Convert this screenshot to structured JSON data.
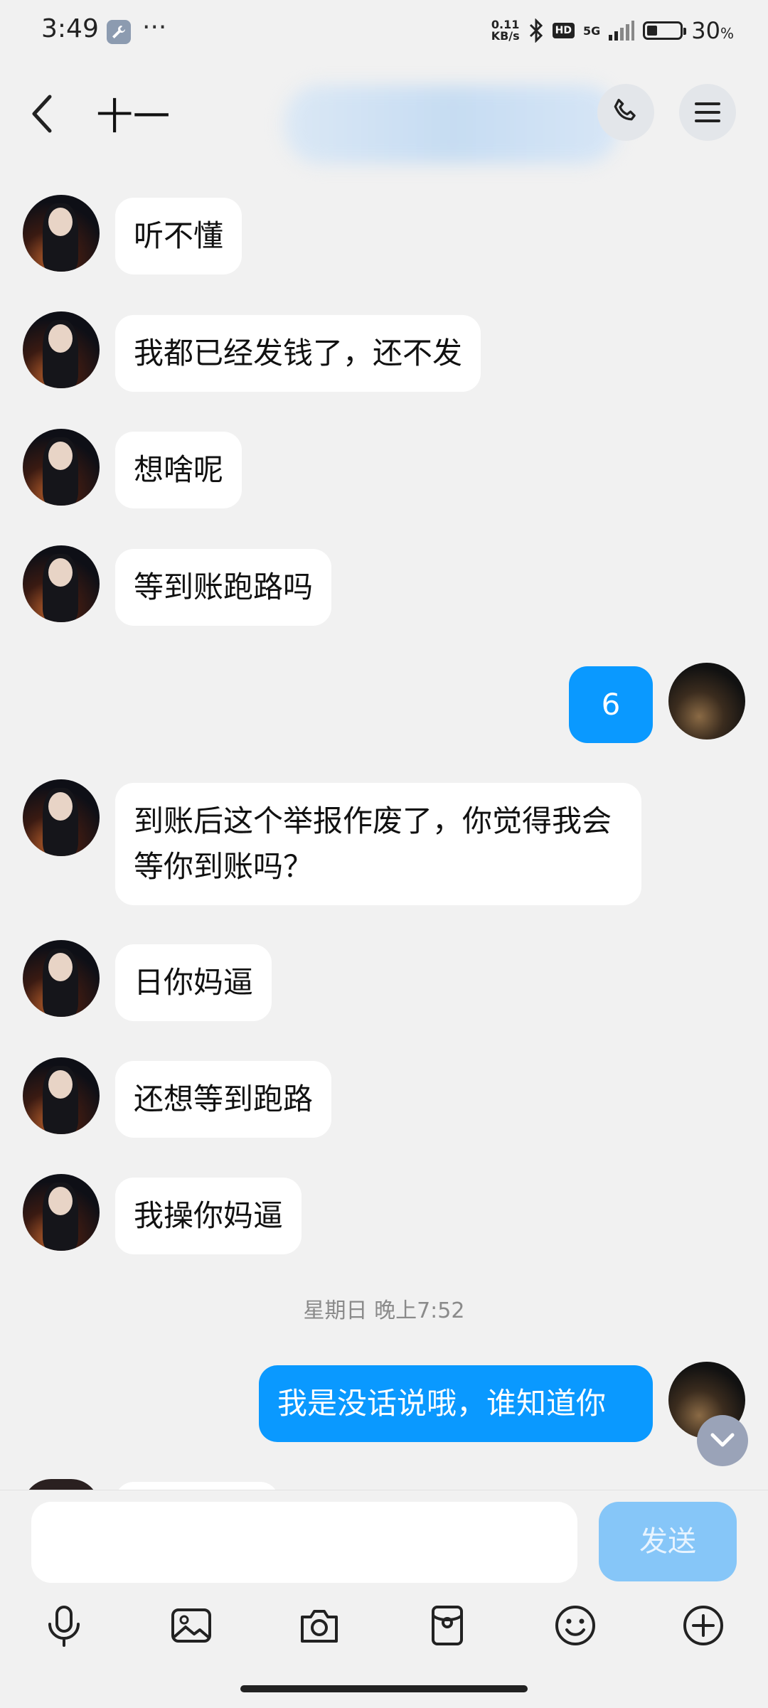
{
  "status_bar": {
    "time": "3:49",
    "dots": "···",
    "net_speed_value": "0.11",
    "net_speed_unit": "KB/s",
    "hd": "HD",
    "network": "5G",
    "battery_percent": "30",
    "battery_symbol": "%"
  },
  "header": {
    "title": "十一"
  },
  "messages": [
    {
      "side": "left",
      "text": "听不懂"
    },
    {
      "side": "left",
      "text": "我都已经发钱了，还不发"
    },
    {
      "side": "left",
      "text": "想啥呢"
    },
    {
      "side": "left",
      "text": "等到账跑路吗"
    },
    {
      "side": "right",
      "text": "6"
    },
    {
      "side": "left",
      "text": "到账后这个举报作废了，你觉得我会等你到账吗？"
    },
    {
      "side": "left",
      "text": "日你妈逼"
    },
    {
      "side": "left",
      "text": "还想等到跑路"
    },
    {
      "side": "left",
      "text": "我操你妈逼"
    },
    {
      "side": "right",
      "text": "我是没话说哦，谁知道你"
    }
  ],
  "timestamp": "星期日 晚上7:52",
  "input": {
    "placeholder": "",
    "send_label": "发送"
  },
  "tools": [
    "mic-icon",
    "image-icon",
    "camera-icon",
    "red-packet-icon",
    "emoji-icon",
    "plus-icon"
  ],
  "colors": {
    "background": "#f1f1f1",
    "my_bubble": "#0a99ff",
    "their_bubble": "#ffffff",
    "send_button": "#86c6f8"
  }
}
